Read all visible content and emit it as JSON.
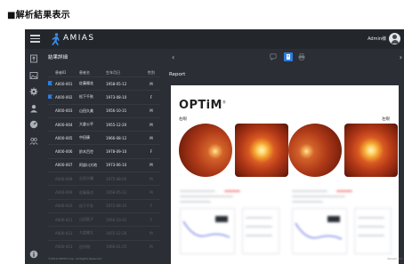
{
  "page_heading": "■解析結果表示",
  "app": {
    "name": "AMIAS",
    "user_name": "Admin様",
    "panel_title": "結果詳細",
    "report_label": "Report",
    "report_brand": "OPTiM",
    "eye_right_label": "右眼",
    "eye_left_label": "左眼",
    "footer_text": "©2019 OPTiM Corp. All Rights Reserved.",
    "version_text": "Version 1.0"
  },
  "table": {
    "headers": [
      "",
      "患者ID",
      "患者名",
      "生年月日",
      "性別"
    ],
    "rows": [
      {
        "flag": true,
        "id": "A000-001",
        "name": "佐藤陽花",
        "dob": "1958-05-12",
        "sex": "M",
        "dim": false
      },
      {
        "flag": true,
        "id": "A000-002",
        "name": "松下千秋",
        "dob": "1973-08-10",
        "sex": "F",
        "dim": false
      },
      {
        "flag": false,
        "id": "A000-003",
        "name": "山田久美",
        "dob": "1956-10-31",
        "sex": "M",
        "dim": false
      },
      {
        "flag": false,
        "id": "A000-004",
        "name": "大倉公平",
        "dob": "1955-12-20",
        "sex": "M",
        "dim": false
      },
      {
        "flag": false,
        "id": "A000-005",
        "name": "中田康",
        "dob": "1966-08-12",
        "sex": "M",
        "dim": false
      },
      {
        "flag": false,
        "id": "A000-006",
        "name": "鈴木百世",
        "dob": "1978-09-10",
        "sex": "F",
        "dim": false
      },
      {
        "flag": false,
        "id": "A000-007",
        "name": "阿部川大地",
        "dob": "1973-06-10",
        "sex": "M",
        "dim": false
      },
      {
        "flag": false,
        "id": "A000-008",
        "name": "吉田大輔",
        "dob": "1975-08-05",
        "sex": "M",
        "dim": true
      },
      {
        "flag": false,
        "id": "A000-009",
        "name": "佐藤真也",
        "dob": "1958-05-12",
        "sex": "M",
        "dim": true
      },
      {
        "flag": false,
        "id": "A000-010",
        "name": "松下千秋",
        "dob": "1973-08-10",
        "sex": "F",
        "dim": true
      },
      {
        "flag": false,
        "id": "A000-011",
        "name": "山田直子",
        "dob": "1956-10-31",
        "sex": "F",
        "dim": true
      },
      {
        "flag": false,
        "id": "A000-012",
        "name": "大倉健太",
        "dob": "1955-12-20",
        "sex": "M",
        "dim": true
      },
      {
        "flag": false,
        "id": "A000-013",
        "name": "田村翔",
        "dob": "1966-01-25",
        "sex": "M",
        "dim": true
      }
    ]
  },
  "icons": {
    "menu": "hamburger-menu-icon",
    "sidebar": [
      "upload-icon",
      "image-icon",
      "settings-icon",
      "user-icon",
      "dashboard-icon",
      "group-icon",
      "info-icon"
    ],
    "toolbar": [
      "comment-icon",
      "document-icon",
      "print-icon"
    ]
  },
  "colors": {
    "accent": "#2f7de1",
    "app_bg": "#2b2f35",
    "topbar_bg": "#23272c"
  }
}
